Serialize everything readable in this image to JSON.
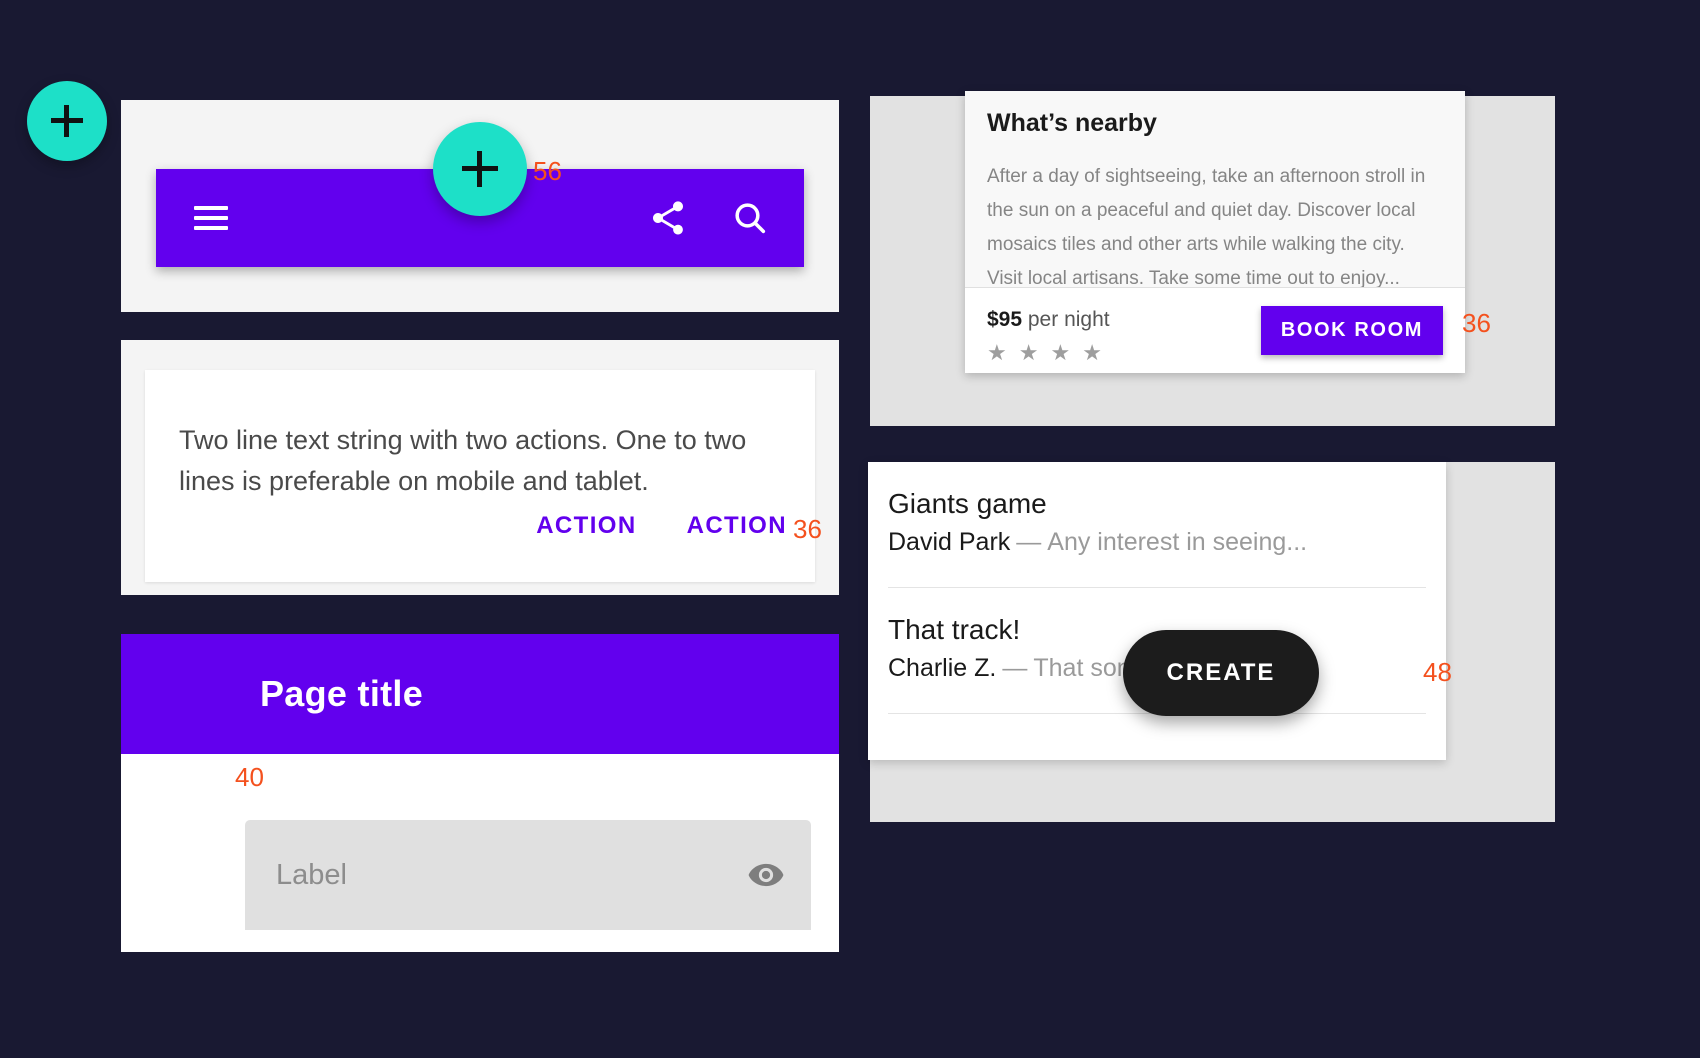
{
  "background_color": "#191932",
  "colors": {
    "purple": "#6200EE",
    "teal": "#1DE0C8",
    "annotation_red": "#F4511E",
    "panel_gray": "#E2E2E2",
    "card_gray": "#F4F4F4",
    "dark_fab": "#1C1C1C"
  },
  "app_bar_card": {
    "menu_icon": "hamburger-menu-icon",
    "share_icon": "share-icon",
    "search_icon": "search-icon",
    "fab_icon": "plus-icon",
    "annotation": "56"
  },
  "snackbar_card": {
    "message": "Two line text string with two actions. One to two lines is preferable on mobile and tablet.",
    "action_one": "ACTION",
    "action_two": "ACTION",
    "annotation": "36"
  },
  "page_title_card": {
    "title": "Page title",
    "fab_icon": "plus-icon",
    "fab_annotation": "40",
    "text_field": {
      "label": "Label",
      "value": "",
      "trailing_icon": "visibility-eye-icon"
    }
  },
  "nearby_card": {
    "title": "What’s nearby",
    "body": "After a day of sightseeing, take an afternoon stroll in the sun on a peaceful and quiet day. Discover local mosaics tiles and other arts while walking the city. Visit local artisans. Take some time out to enjoy...",
    "price": "$95",
    "price_suffix": " per night",
    "rating_stars": 4,
    "star_glyph": "★",
    "book_button": "BOOK ROOM",
    "annotation": "36"
  },
  "mail_card": {
    "items": [
      {
        "subject": "Giants game",
        "sender": "David Park",
        "dash": "—",
        "preview": "Any interest in seeing..."
      },
      {
        "subject": "That track!",
        "sender": "Charlie Z.",
        "dash": "—",
        "preview": "That song we..."
      }
    ],
    "create_button": "CREATE",
    "annotation": "48"
  }
}
